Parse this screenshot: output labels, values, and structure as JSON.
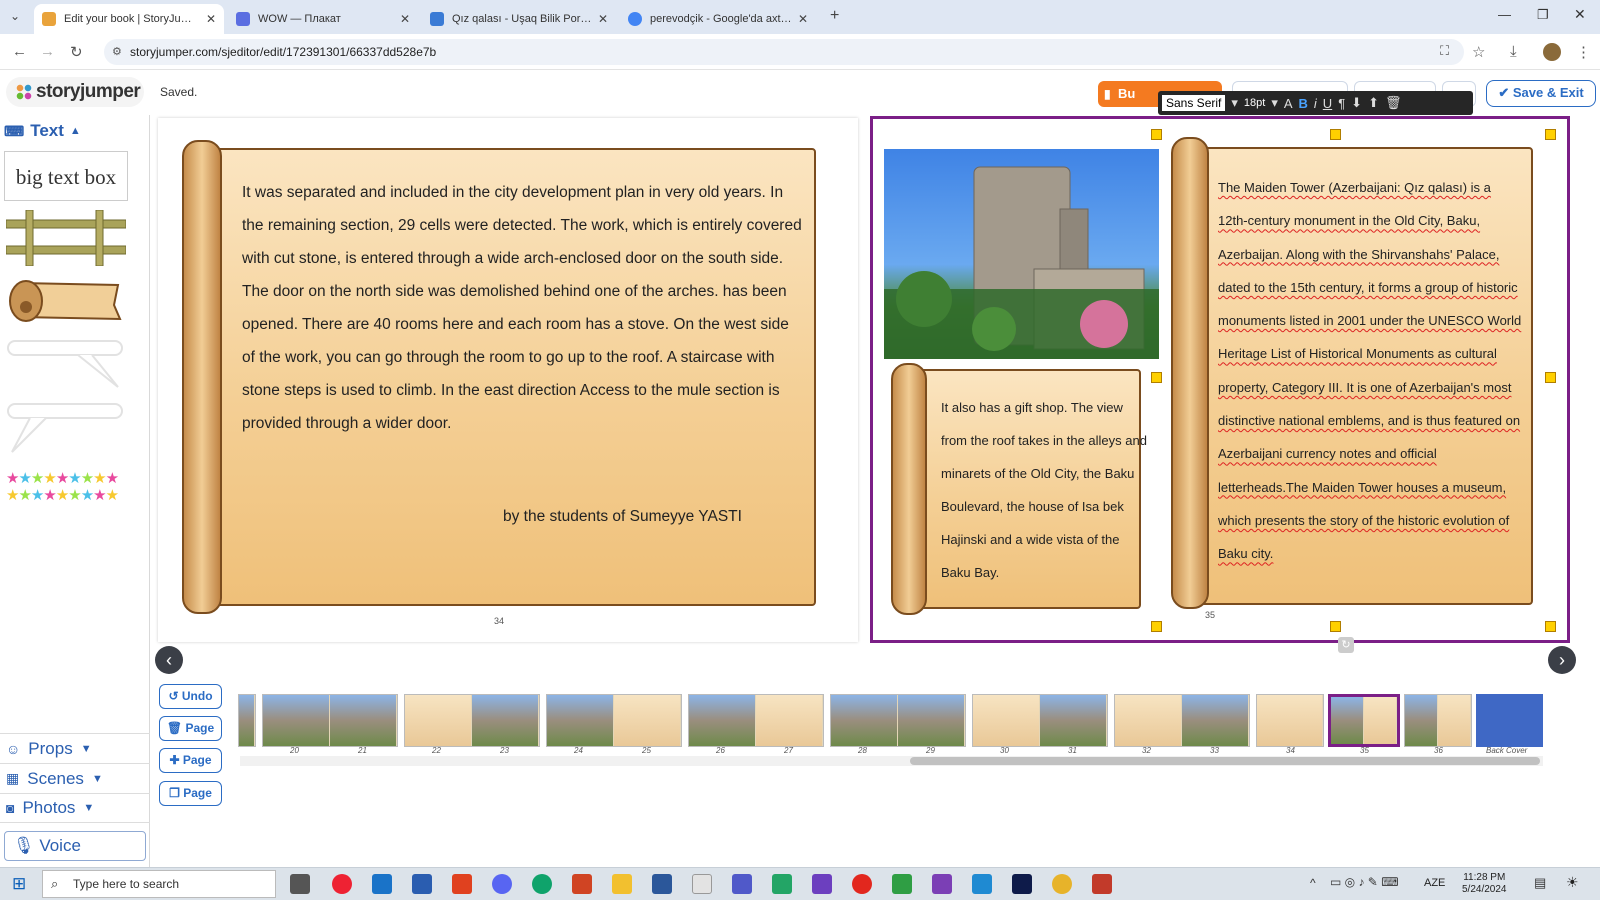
{
  "browser": {
    "tabs": [
      {
        "title": "Edit your book | StoryJumper",
        "active": true,
        "favicon_color": "#e9a33b"
      },
      {
        "title": "WOW — Плакат",
        "active": false,
        "favicon_color": "#5b6ee1"
      },
      {
        "title": "Qız qalası - Uşaq Bilik Portalı",
        "active": false,
        "favicon_color": "#3a7bd5"
      },
      {
        "title": "perevodçik - Google'da axtarış",
        "active": false,
        "favicon_color": "#4285f4"
      }
    ],
    "url": "storyjumper.com/sjeditor/edit/172391301/66337dd528e7b"
  },
  "app": {
    "logo": "storyjumper",
    "status": "Saved.",
    "buy_label": "Bu",
    "save_exit_label": "Save & Exit",
    "accent_color": "#2b6cc4"
  },
  "format_toolbar": {
    "font": "Sans Serif",
    "size": "18pt",
    "icons": [
      "font-color-icon",
      "bold-icon",
      "italic-icon",
      "underline-icon",
      "paragraph-icon",
      "move-down-icon",
      "move-up-icon",
      "trash-icon"
    ]
  },
  "sidebar": {
    "text_header": "Text",
    "big_text_box": "big text box",
    "sections": [
      "Props",
      "Scenes",
      "Photos"
    ],
    "voice": "Voice"
  },
  "left_page": {
    "body": "It was separated and included in the city development plan in very old years. In the remaining section, 29 cells were detected. The work, which is entirely covered with cut stone, is entered through a wide arch-enclosed door on the south side. The door on the north side was demolished behind one of the arches. has been opened. There are 40 rooms here and each room has a stove. On the west side of the work, you can go through the room to go up to the roof. A staircase with stone steps is used to climb. In the east direction Access to the mule section is provided through a wider door.",
    "signature": "by the students of Sumeyye YASTI",
    "page_number": "34"
  },
  "right_page": {
    "small_text": "It also has a gift shop. The view from the roof takes in the alleys and minarets of the Old City, the Baku Boulevard, the house of Isa bek Hajinski and a wide vista of the Baku Bay.",
    "main_text": "The Maiden Tower (Azerbaijani: Qız qalası) is a 12th-century monument in the Old City, Baku, Azerbaijan. Along with the Shirvanshahs' Palace, dated to the 15th century, it forms a group of historic monuments listed in 2001 under the UNESCO World Heritage List of Historical Monuments as cultural property, Category III. It is one of Azerbaijan's most distinctive national emblems, and is thus featured on Azerbaijani currency notes and official letterheads.The Maiden Tower houses a museum, which presents the story of the historic evolution of Baku city.",
    "page_number": "35",
    "selection_color": "#7b1f87"
  },
  "edit_buttons": {
    "undo": "Undo",
    "delete_page": "Page",
    "add_page": "Page",
    "copy_page": "Page"
  },
  "thumbnails": {
    "labels": [
      "20",
      "21",
      "22",
      "23",
      "24",
      "25",
      "26",
      "27",
      "28",
      "29",
      "30",
      "31",
      "32",
      "33",
      "34",
      "35",
      "36",
      "Back Cover"
    ],
    "selected": "35"
  },
  "taskbar": {
    "search_placeholder": "Type here to search",
    "language": "AZE",
    "time": "11:28 PM",
    "date": "5/24/2024"
  }
}
